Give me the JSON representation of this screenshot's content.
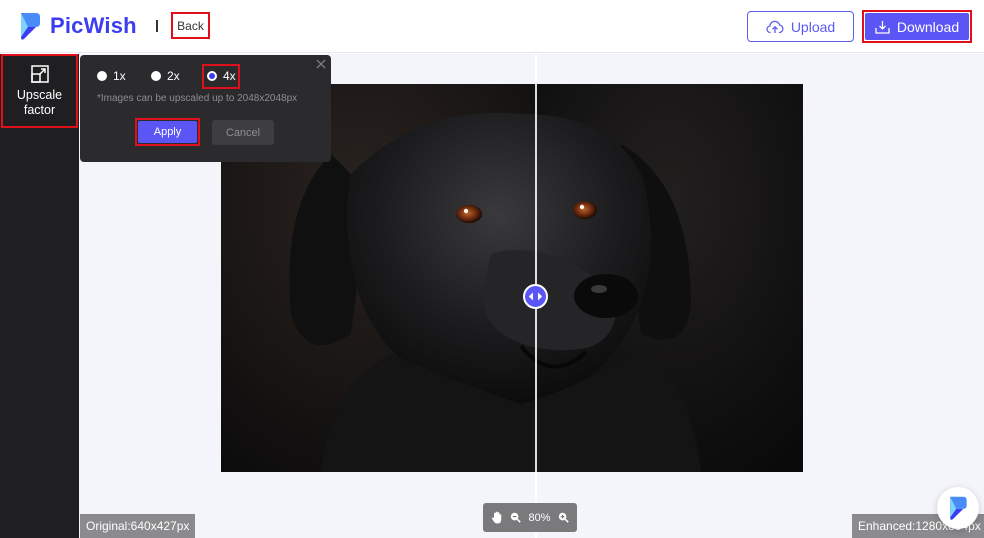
{
  "app": {
    "name": "PicWish",
    "brand_color": "#5b55f6",
    "highlight_color": "#e0101a"
  },
  "header": {
    "back_label": "Back",
    "upload_label": "Upload",
    "download_label": "Download",
    "upload_icon": "cloud-upload-icon",
    "download_icon": "download-icon"
  },
  "sidebar": {
    "tool_icon": "upscale-icon",
    "tool_label": "Upscale factor"
  },
  "popup": {
    "options": [
      {
        "label": "1x",
        "selected": false
      },
      {
        "label": "2x",
        "selected": false
      },
      {
        "label": "4x",
        "selected": true
      }
    ],
    "note": "*Images can be upscaled up to 2048x2048px",
    "apply_label": "Apply",
    "cancel_label": "Cancel"
  },
  "viewer": {
    "zoom_level": "80%",
    "original_label": "Original:640x427px",
    "enhanced_label": "Enhanced:1280x854px"
  }
}
